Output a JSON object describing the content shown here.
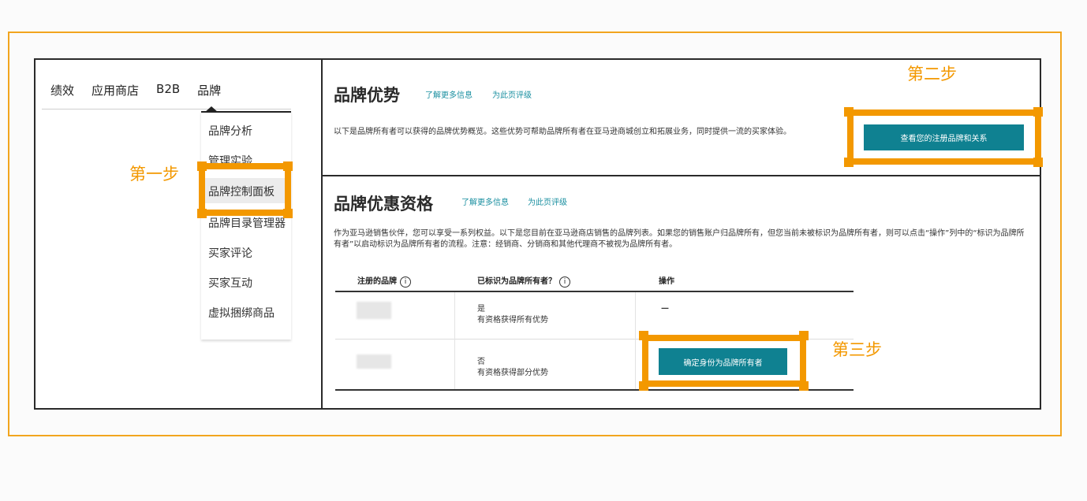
{
  "topnav": {
    "items": [
      "绩效",
      "应用商店",
      "B2B",
      "品牌"
    ]
  },
  "menu": {
    "items": [
      "品牌分析",
      "管理实验",
      "品牌控制面板",
      "品牌目录管理器",
      "买家评论",
      "买家互动",
      "虚拟捆绑商品"
    ],
    "selected": "品牌控制面板"
  },
  "steps": {
    "step1": "第一步",
    "step2": "第二步",
    "step3": "第三步"
  },
  "brand_advantage": {
    "title": "品牌优势",
    "link_more": "了解更多信息",
    "link_rate": "为此页评级",
    "description": "以下是品牌所有者可以获得的品牌优势概览。这些优势可帮助品牌所有者在亚马逊商城创立和拓展业务，同时提供一流的买家体验。",
    "button": "查看您的注册品牌和关系"
  },
  "brand_eligibility": {
    "title": "品牌优惠资格",
    "link_more": "了解更多信息",
    "link_rate": "为此页评级",
    "description": "作为亚马逊销售伙伴，您可以享受一系列权益。以下是您目前在亚马逊商店销售的品牌列表。如果您的销售账户归品牌所有，但您当前未被标识为品牌所有者，则可以点击“操作”列中的“标识为品牌所有者”以启动标识为品牌所有者的流程。注意：经销商、分销商和其他代理商不被视为品牌所有者。",
    "table": {
      "headers": [
        "注册的品牌",
        "已标识为品牌所有者？",
        "操作"
      ],
      "rows": [
        {
          "status": "是",
          "detail": "有资格获得所有优势",
          "action": "—"
        },
        {
          "status": "否",
          "detail": "有资格获得部分优势",
          "action": "确定身份为品牌所有者"
        }
      ]
    }
  },
  "colors": {
    "accent": "#f39800",
    "teal": "#0f8191",
    "link": "#1a8fa0"
  }
}
